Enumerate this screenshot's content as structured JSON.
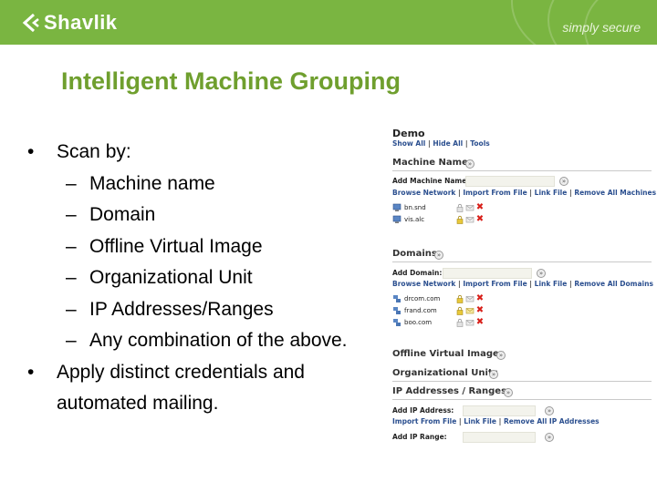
{
  "header": {
    "logo_text": "Shavlik",
    "tagline": "simply secure",
    "brand_color": "#7ab541"
  },
  "slide": {
    "title": "Intelligent Machine Grouping",
    "title_color": "#6f9f2e",
    "bullet1": "Scan by:",
    "sub_items": [
      "Machine name",
      "Domain",
      "Offline Virtual Image",
      "Organizational Unit",
      "IP Addresses/Ranges",
      "Any combination of the above."
    ],
    "bullet2_line1": "Apply distinct credentials and",
    "bullet2_line2": "automated mailing."
  },
  "panel": {
    "title": "Demo",
    "top_links": [
      "Show All",
      "Hide All",
      "Tools"
    ],
    "machine_names": {
      "heading": "Machine Names",
      "add_label": "Add Machine Name:",
      "links": [
        "Browse Network",
        "Import From File",
        "Link File",
        "Remove All Machines"
      ],
      "rows": [
        "bn.snd",
        "vis.alc"
      ]
    },
    "domains": {
      "heading": "Domains",
      "add_label": "Add Domain:",
      "links": [
        "Browse Network",
        "Import From File",
        "Link File",
        "Remove All Domains"
      ],
      "rows": [
        "drcom.com",
        "frand.com",
        "boo.com"
      ]
    },
    "offline_heading": "Offline Virtual Images",
    "ou_heading": "Organizational Units",
    "ip": {
      "heading": "IP Addresses / Ranges",
      "add_address_label": "Add IP Address:",
      "links": [
        "Import From File",
        "Link File",
        "Remove All IP Addresses"
      ],
      "add_range_label": "Add IP Range:"
    },
    "icons": {
      "section_toggle": "expand-circle-icon",
      "machine": "computer-icon",
      "credentials": "lock-icon",
      "mail": "envelope-icon",
      "remove": "red-x-icon"
    },
    "remove_color": "#d8201a",
    "link_color": "#2b4f8f"
  }
}
